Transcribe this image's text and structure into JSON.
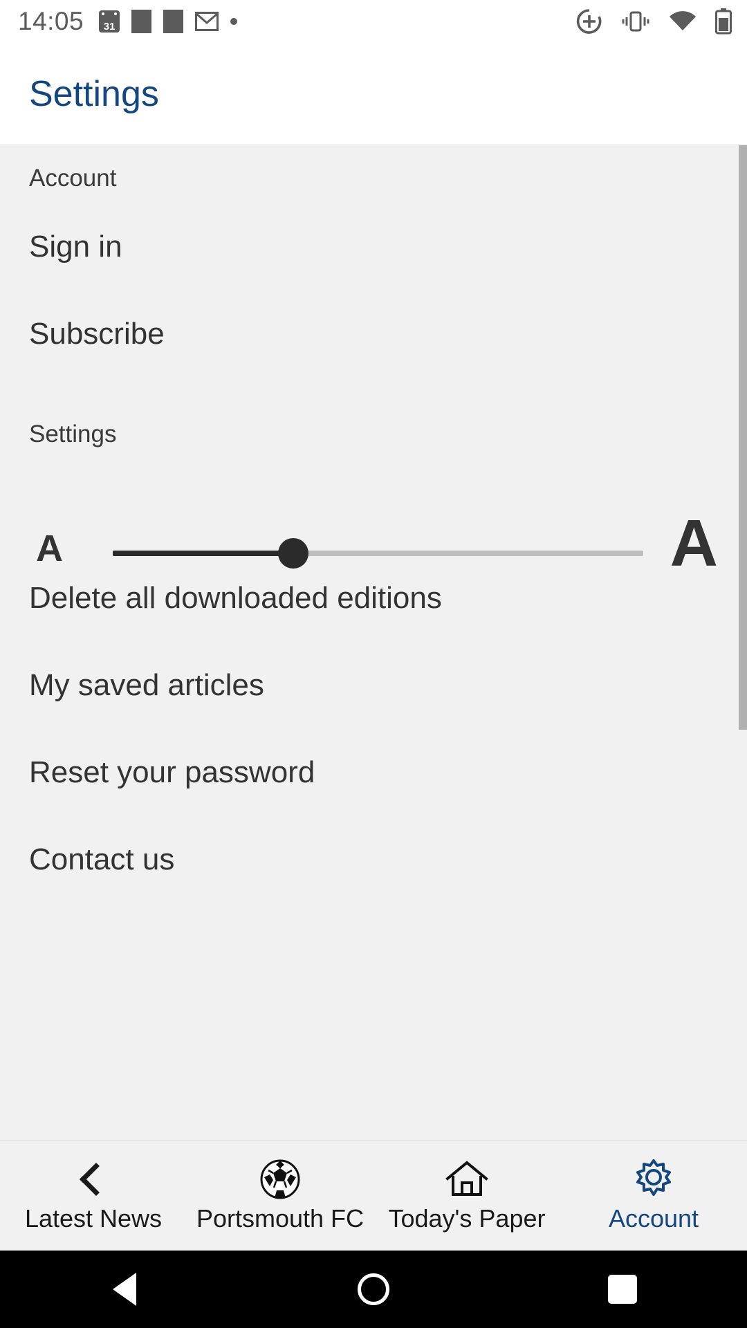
{
  "status_bar": {
    "time": "14:05",
    "calendar_day": "31",
    "left_icons": [
      "calendar-icon",
      "app-square-icon",
      "app-square-icon",
      "gmail-icon",
      "dot-icon"
    ],
    "right_icons": [
      "accessibility-zoom-icon",
      "vibrate-icon",
      "wifi-icon",
      "battery-icon"
    ]
  },
  "app_bar": {
    "title": "Settings",
    "title_color": "#14477f"
  },
  "content": {
    "sections": [
      {
        "label": "Account"
      },
      {
        "label": "Settings"
      }
    ],
    "account_items": [
      {
        "label": "Sign in"
      },
      {
        "label": "Subscribe"
      }
    ],
    "font_slider": {
      "min_label": "A",
      "max_label": "A",
      "value_percent": 34
    },
    "settings_items": [
      {
        "label": "Delete all downloaded editions"
      },
      {
        "label": "My saved articles"
      },
      {
        "label": "Reset your password"
      },
      {
        "label": "Contact us"
      }
    ]
  },
  "tab_bar": {
    "active_color": "#14477f",
    "tabs": [
      {
        "label": "Latest News",
        "icon": "chevron-left-icon",
        "active": false
      },
      {
        "label": "Portsmouth FC",
        "icon": "football-icon",
        "active": false
      },
      {
        "label": "Today's Paper",
        "icon": "home-icon",
        "active": false
      },
      {
        "label": "Account",
        "icon": "gear-icon",
        "active": true
      }
    ]
  },
  "system_nav": {
    "buttons": [
      "back-button",
      "home-button",
      "recents-button"
    ]
  }
}
